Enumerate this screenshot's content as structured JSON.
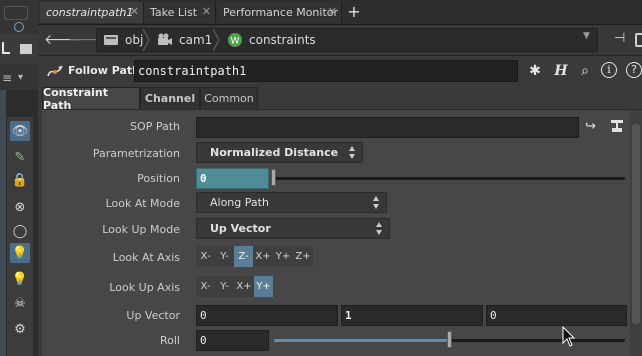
{
  "tabs": [
    {
      "label": "constraintpath1",
      "active": true
    },
    {
      "label": "Take List",
      "active": false
    },
    {
      "label": "Performance Monitor",
      "active": false
    }
  ],
  "path": {
    "crumbs": [
      "obj",
      "cam1",
      "constraints"
    ]
  },
  "node": {
    "type_label": "Follow Path",
    "name": "constraintpath1",
    "help_icon_text": "H"
  },
  "parm_tabs": [
    "Constraint Path",
    "Channel",
    "Common"
  ],
  "parms": {
    "sop_path": {
      "label": "SOP Path",
      "value": ""
    },
    "parametrization": {
      "label": "Parametrization",
      "value": "Normalized Distance"
    },
    "position": {
      "label": "Position",
      "value": "0",
      "slider_fraction": 0.0
    },
    "look_at_mode": {
      "label": "Look At Mode",
      "value": "Along Path"
    },
    "look_up_mode": {
      "label": "Look Up Mode",
      "value": "Up Vector"
    },
    "look_at_axis": {
      "label": "Look At Axis",
      "options": [
        "X-",
        "Y-",
        "Z-",
        "X+",
        "Y+",
        "Z+"
      ],
      "selected": "Z-"
    },
    "look_up_axis": {
      "label": "Look Up Axis",
      "options": [
        "X-",
        "Y-",
        "X+",
        "Y+"
      ],
      "selected": "Y+"
    },
    "up_vector": {
      "label": "Up Vector",
      "values": [
        "0",
        "1",
        "0"
      ]
    },
    "roll": {
      "label": "Roll",
      "value": "0",
      "slider_fraction": 0.5
    }
  },
  "colors": {
    "selected_axis": "#5a7e95",
    "position_field": "#4e8d95",
    "network_icon": "#4fa34f"
  }
}
